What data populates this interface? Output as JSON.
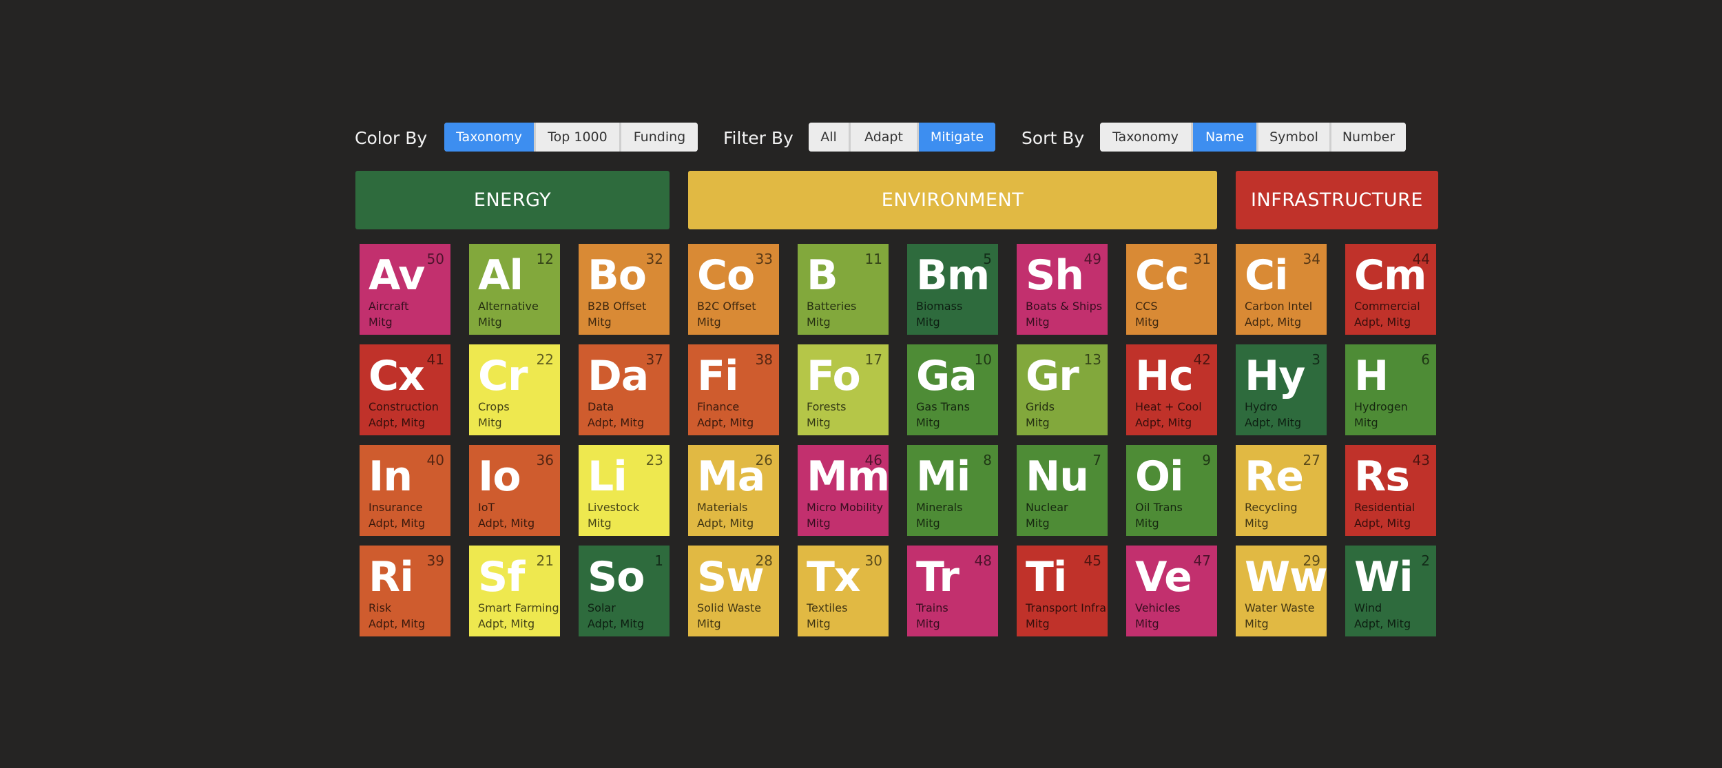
{
  "controls": {
    "color_by": {
      "label": "Color By",
      "options": [
        "Taxonomy",
        "Top 1000",
        "Funding"
      ],
      "selected": "Taxonomy"
    },
    "filter_by": {
      "label": "Filter By",
      "options": [
        "All",
        "Adapt",
        "Mitigate"
      ],
      "selected": "Mitigate"
    },
    "sort_by": {
      "label": "Sort By",
      "options": [
        "Taxonomy",
        "Name",
        "Symbol",
        "Number"
      ],
      "selected": "Name"
    }
  },
  "categories": [
    {
      "label": "ENERGY",
      "color": "#2e6b3d"
    },
    {
      "label": "ENVIRONMENT",
      "color": "#e1b943"
    },
    {
      "label": "INFRASTRUCTURE",
      "color": "#c0322a"
    }
  ],
  "colors": {
    "magenta": "#c2306e",
    "lime": "#82a83c",
    "orange": "#d98a35",
    "darkgreen": "#2e6b3d",
    "red": "#c0322a",
    "yellow": "#eee84f",
    "burnt": "#cf5c2e",
    "yellowgreen": "#b5c648",
    "green": "#4e8c36",
    "gold": "#e1b943",
    "accent_blue": "#3d8ef0",
    "background": "#252423"
  },
  "elements": [
    {
      "symbol": "Av",
      "number": "50",
      "name": "Aircraft",
      "tags": "Mitg",
      "color": "magenta"
    },
    {
      "symbol": "Al",
      "number": "12",
      "name": "Alternative",
      "tags": "Mitg",
      "color": "lime"
    },
    {
      "symbol": "Bo",
      "number": "32",
      "name": "B2B Offset",
      "tags": "Mitg",
      "color": "orange"
    },
    {
      "symbol": "Co",
      "number": "33",
      "name": "B2C Offset",
      "tags": "Mitg",
      "color": "orange"
    },
    {
      "symbol": "B",
      "number": "11",
      "name": "Batteries",
      "tags": "Mitg",
      "color": "lime"
    },
    {
      "symbol": "Bm",
      "number": "5",
      "name": "Biomass",
      "tags": "Mitg",
      "color": "darkgreen"
    },
    {
      "symbol": "Sh",
      "number": "49",
      "name": "Boats & Ships",
      "tags": "Mitg",
      "color": "magenta"
    },
    {
      "symbol": "Cc",
      "number": "31",
      "name": "CCS",
      "tags": "Mitg",
      "color": "orange"
    },
    {
      "symbol": "Ci",
      "number": "34",
      "name": "Carbon Intel",
      "tags": "Adpt, Mitg",
      "color": "orange"
    },
    {
      "symbol": "Cm",
      "number": "44",
      "name": "Commercial",
      "tags": "Adpt, Mitg",
      "color": "red"
    },
    {
      "symbol": "Cx",
      "number": "41",
      "name": "Construction",
      "tags": "Adpt, Mitg",
      "color": "red"
    },
    {
      "symbol": "Cr",
      "number": "22",
      "name": "Crops",
      "tags": "Mitg",
      "color": "yellow"
    },
    {
      "symbol": "Da",
      "number": "37",
      "name": "Data",
      "tags": "Adpt, Mitg",
      "color": "burnt"
    },
    {
      "symbol": "Fi",
      "number": "38",
      "name": "Finance",
      "tags": "Adpt, Mitg",
      "color": "burnt"
    },
    {
      "symbol": "Fo",
      "number": "17",
      "name": "Forests",
      "tags": "Mitg",
      "color": "yellowgreen"
    },
    {
      "symbol": "Ga",
      "number": "10",
      "name": "Gas Trans",
      "tags": "Mitg",
      "color": "green"
    },
    {
      "symbol": "Gr",
      "number": "13",
      "name": "Grids",
      "tags": "Mitg",
      "color": "lime"
    },
    {
      "symbol": "Hc",
      "number": "42",
      "name": "Heat + Cool",
      "tags": "Adpt, Mitg",
      "color": "red"
    },
    {
      "symbol": "Hy",
      "number": "3",
      "name": "Hydro",
      "tags": "Adpt, Mitg",
      "color": "darkgreen"
    },
    {
      "symbol": "H",
      "number": "6",
      "name": "Hydrogen",
      "tags": "Mitg",
      "color": "green"
    },
    {
      "symbol": "In",
      "number": "40",
      "name": "Insurance",
      "tags": "Adpt, Mitg",
      "color": "burnt"
    },
    {
      "symbol": "Io",
      "number": "36",
      "name": "IoT",
      "tags": "Adpt, Mitg",
      "color": "burnt"
    },
    {
      "symbol": "Li",
      "number": "23",
      "name": "Livestock",
      "tags": "Mitg",
      "color": "yellow"
    },
    {
      "symbol": "Ma",
      "number": "26",
      "name": "Materials",
      "tags": "Adpt, Mitg",
      "color": "gold"
    },
    {
      "symbol": "Mm",
      "number": "46",
      "name": "Micro Mobility",
      "tags": "Mitg",
      "color": "magenta"
    },
    {
      "symbol": "Mi",
      "number": "8",
      "name": "Minerals",
      "tags": "Mitg",
      "color": "green"
    },
    {
      "symbol": "Nu",
      "number": "7",
      "name": "Nuclear",
      "tags": "Mitg",
      "color": "green"
    },
    {
      "symbol": "Oi",
      "number": "9",
      "name": "Oil Trans",
      "tags": "Mitg",
      "color": "green"
    },
    {
      "symbol": "Re",
      "number": "27",
      "name": "Recycling",
      "tags": "Mitg",
      "color": "gold"
    },
    {
      "symbol": "Rs",
      "number": "43",
      "name": "Residential",
      "tags": "Adpt, Mitg",
      "color": "red"
    },
    {
      "symbol": "Ri",
      "number": "39",
      "name": "Risk",
      "tags": "Adpt, Mitg",
      "color": "burnt"
    },
    {
      "symbol": "Sf",
      "number": "21",
      "name": "Smart Farming",
      "tags": "Adpt, Mitg",
      "color": "yellow"
    },
    {
      "symbol": "So",
      "number": "1",
      "name": "Solar",
      "tags": "Adpt, Mitg",
      "color": "darkgreen"
    },
    {
      "symbol": "Sw",
      "number": "28",
      "name": "Solid Waste",
      "tags": "Mitg",
      "color": "gold"
    },
    {
      "symbol": "Tx",
      "number": "30",
      "name": "Textiles",
      "tags": "Mitg",
      "color": "gold"
    },
    {
      "symbol": "Tr",
      "number": "48",
      "name": "Trains",
      "tags": "Mitg",
      "color": "magenta"
    },
    {
      "symbol": "Ti",
      "number": "45",
      "name": "Transport Infra",
      "tags": "Mitg",
      "color": "red"
    },
    {
      "symbol": "Ve",
      "number": "47",
      "name": "Vehicles",
      "tags": "Mitg",
      "color": "magenta"
    },
    {
      "symbol": "Ww",
      "number": "29",
      "name": "Water Waste",
      "tags": "Mitg",
      "color": "gold"
    },
    {
      "symbol": "Wi",
      "number": "2",
      "name": "Wind",
      "tags": "Adpt, Mitg",
      "color": "darkgreen"
    }
  ]
}
